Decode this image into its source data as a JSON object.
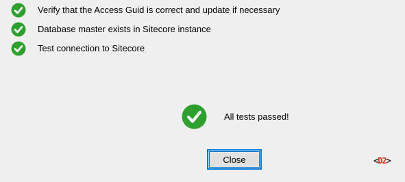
{
  "checks": [
    {
      "label": "Verify that the Access Guid is correct and update if necessary",
      "status": "passed",
      "icon": "check-circle-icon"
    },
    {
      "label": "Database master exists in Sitecore instance",
      "status": "passed",
      "icon": "check-circle-icon"
    },
    {
      "label": "Test connection to Sitecore",
      "status": "passed",
      "icon": "check-circle-icon"
    }
  ],
  "result": {
    "message": "All tests passed!",
    "icon": "check-circle-icon"
  },
  "close_button": {
    "label": "Close"
  },
  "brand_logo": {
    "left": "<",
    "mark": "D2",
    "right": ">"
  },
  "colors": {
    "success_green": "#2ea02e",
    "focus_border": "#0078d7",
    "window_background": "#f0f0f0",
    "logo_red": "#e0301e"
  }
}
